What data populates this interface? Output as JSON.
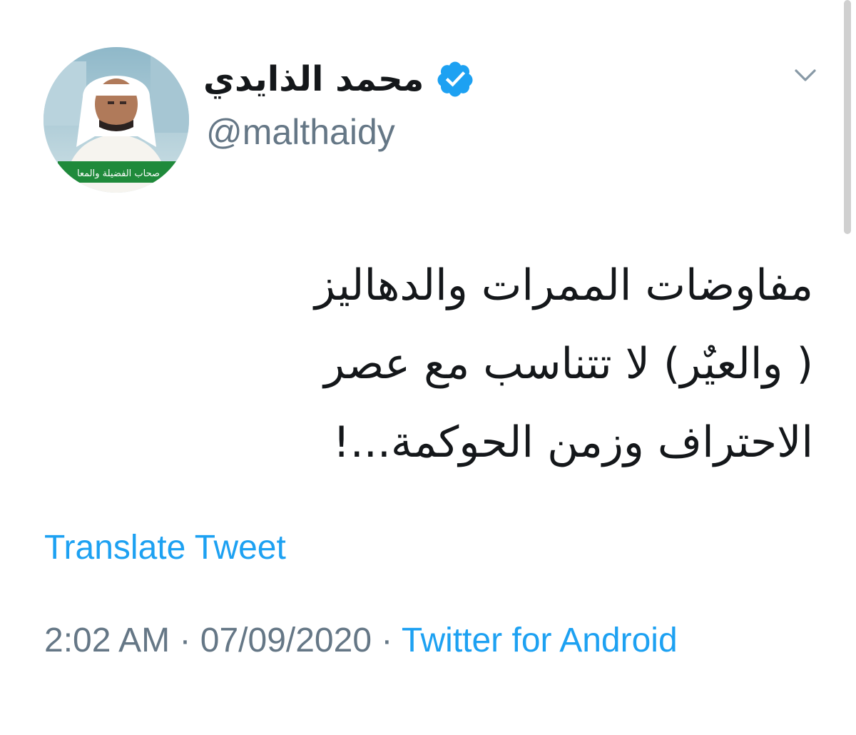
{
  "tweet": {
    "author": {
      "display_name": "محمد الذايدي",
      "handle": "@malthaidy",
      "verified": true,
      "avatar_caption": "صحاب الفضيلة والمعا"
    },
    "text_lines": [
      "مفاوضات الممرات والدهاليز",
      "( والعيٌر) لا تتناسب مع عصر",
      "الاحتراف وزمن الحوكمة...!"
    ],
    "translate_label": "Translate Tweet",
    "meta": {
      "time": "2:02 AM",
      "separator": "·",
      "date": "07/09/2020",
      "source": "Twitter for Android"
    }
  },
  "icons": {
    "verified": "verified-badge-icon",
    "more": "chevron-down-icon"
  },
  "colors": {
    "link": "#1da1f2",
    "secondary_text": "#657786",
    "primary_text": "#14171a",
    "verified_badge": "#1da1f2"
  }
}
